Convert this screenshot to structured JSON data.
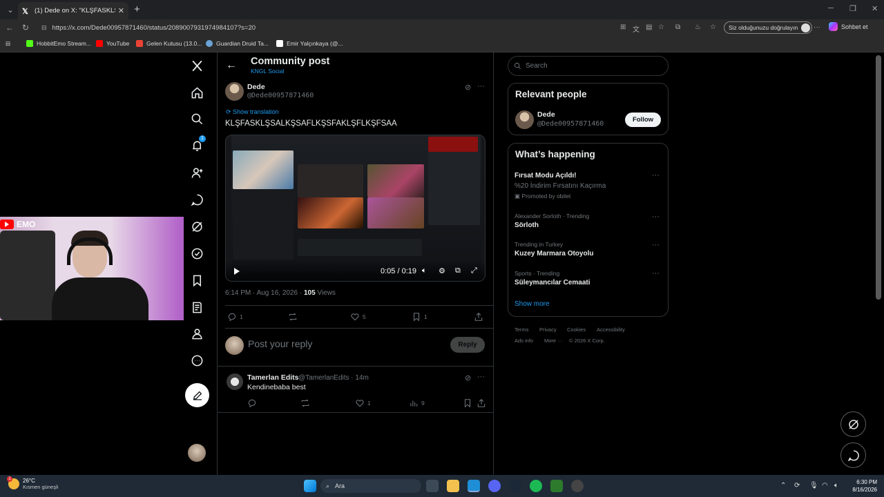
{
  "browser": {
    "tab_title": "(1) Dede on X: \"KLŞFASKLŞSALKŞSA",
    "url": "https://x.com/Dede00957871460/status/2089007931974984107?s=20",
    "verify_label": "Siz olduğunuzu doğrulayın",
    "copilot_label": "Sohbet et",
    "bookmarks": [
      {
        "label": "HobbitEmo Stream...",
        "color": "#53fc18"
      },
      {
        "label": "YouTube",
        "color": "#ff0000"
      },
      {
        "label": "Gelen Kutusu (13.0...",
        "color": "#ea4335"
      },
      {
        "label": "Guardian Druid Ta...",
        "color": "#6ba3d6"
      },
      {
        "label": "Emir Yalçınkaya (@...",
        "color": "#ffffff"
      }
    ]
  },
  "nav": {
    "notification_count": "1"
  },
  "header": {
    "title": "Community post",
    "community": "KNGL Social"
  },
  "post": {
    "author_name": "Dede",
    "author_handle": "@Dede00957871460",
    "show_translation": "Show translation",
    "text": "KLŞFASKLŞSALKŞSAFLKŞSFAKLŞFLKŞFSAA",
    "video_time": "0:05 / 0:19",
    "timestamp": "6:14 PM · Aug 16, 2026 · ",
    "views_count": "105",
    "views_label": " Views",
    "replies": "1",
    "likes": "5",
    "bookmarks": "1",
    "reply_placeholder": "Post your reply",
    "reply_button": "Reply"
  },
  "reply": {
    "author_name": "Tamerlan Edits",
    "author_handle": "@TamerlanEdits · 14m",
    "text": "Kendinebaba best",
    "likes": "1",
    "views": "9"
  },
  "webcam": {
    "label": "EMO"
  },
  "sidebar": {
    "search_placeholder": "Search",
    "relevant_title": "Relevant people",
    "person_name": "Dede",
    "person_handle": "@Dede00957871460",
    "follow_label": "Follow",
    "happening_title": "What’s happening",
    "trends": [
      {
        "category": "",
        "title": "Fırsat Modu Açıldı!",
        "sub": "%20 İndirim Fırsatını Kaçırma",
        "promo": "Promoted by obilet"
      },
      {
        "category": "Alexander Sorloth · Trending",
        "title": "Sörloth"
      },
      {
        "category": "Trending in Turkey",
        "title": "Kuzey Marmara Otoyolu"
      },
      {
        "category": "Sports · Trending",
        "title": "Süleymancılar Cemaati"
      }
    ],
    "show_more": "Show more",
    "footer": [
      "Terms",
      "Privacy",
      "Cookies",
      "Accessibility",
      "Ads info",
      "More ···",
      "© 2026 X Corp."
    ]
  },
  "taskbar": {
    "temperature": "26°C",
    "weather": "Kısmen güneşli",
    "search": "Ara",
    "time": "6:30 PM",
    "date": "8/16/2026"
  },
  "colors": {
    "accent": "#1d9bf0",
    "background": "#000000",
    "border": "#2f3336",
    "muted": "#71767b"
  }
}
